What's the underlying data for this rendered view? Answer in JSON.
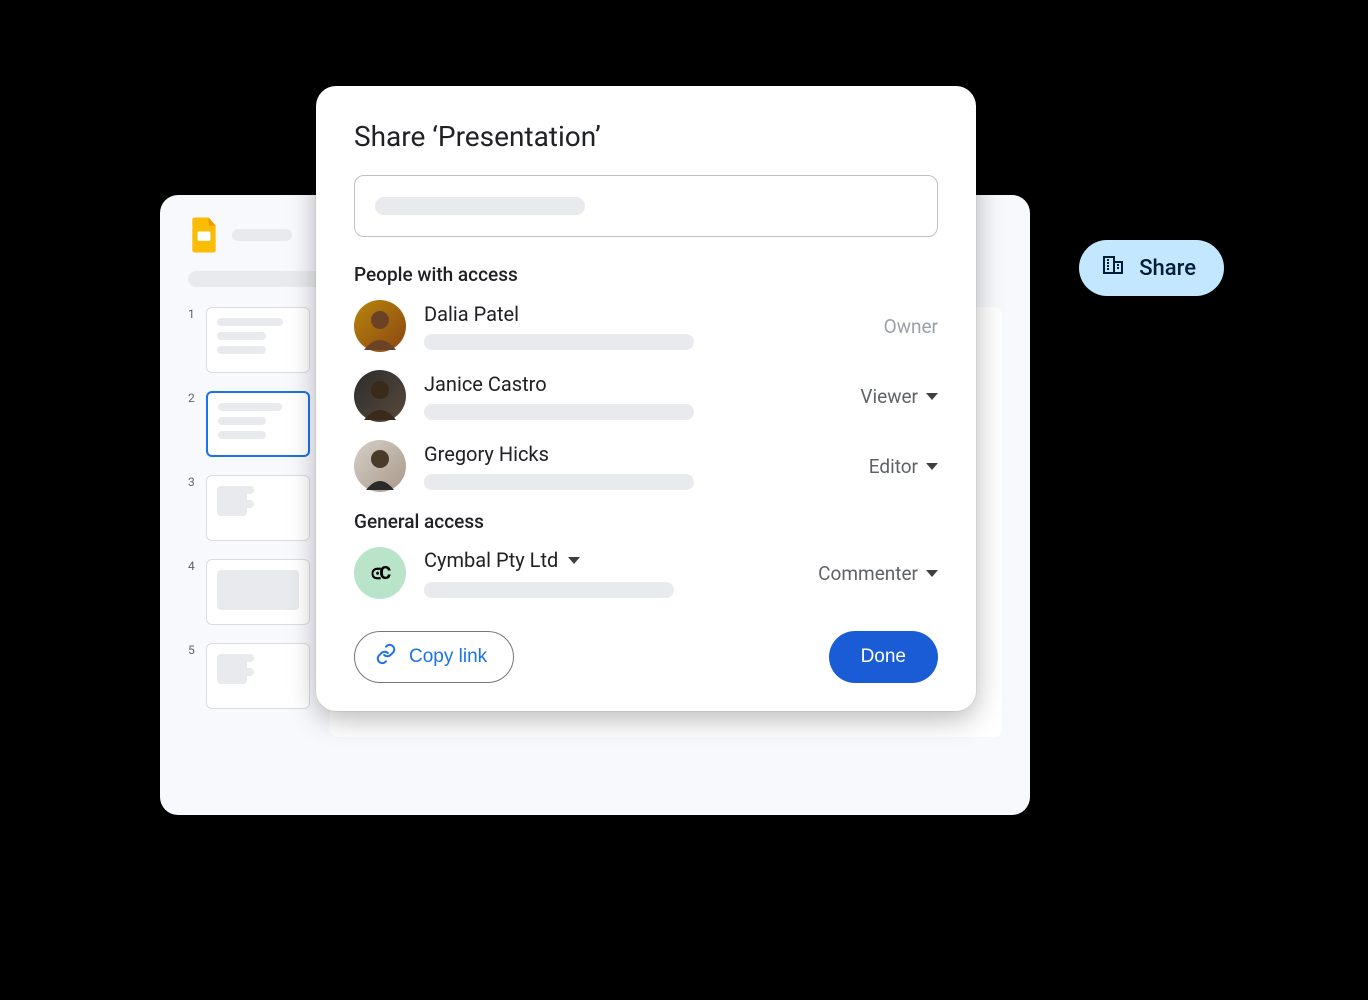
{
  "shareButton": {
    "label": "Share"
  },
  "slides": {
    "thumbs": [
      "1",
      "2",
      "3",
      "4",
      "5"
    ],
    "selectedIndex": 1
  },
  "dialog": {
    "title": "Share ‘Presentation’",
    "peopleSection": "People with access",
    "people": [
      {
        "name": "Dalia Patel",
        "role": "Owner",
        "roleEditable": false,
        "avatar": "dalia"
      },
      {
        "name": "Janice Castro",
        "role": "Viewer",
        "roleEditable": true,
        "avatar": "janice"
      },
      {
        "name": "Gregory Hicks",
        "role": "Editor",
        "roleEditable": true,
        "avatar": "gregory"
      }
    ],
    "generalSection": "General access",
    "org": {
      "name": "Cymbal Pty Ltd",
      "role": "Commenter",
      "logoText": "⪽C"
    },
    "copyLink": "Copy link",
    "done": "Done"
  }
}
